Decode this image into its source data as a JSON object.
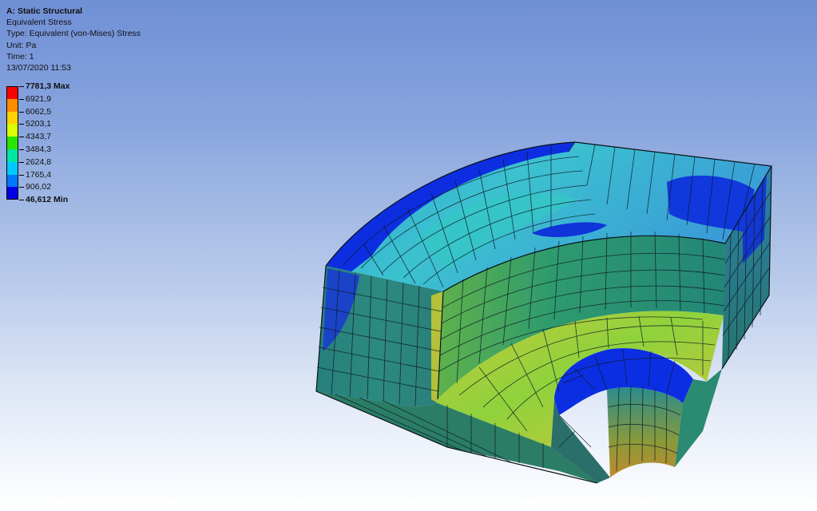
{
  "header": {
    "title": "A: Static Structural",
    "result": "Equivalent Stress",
    "type": "Type: Equivalent (von-Mises) Stress",
    "unit": "Unit: Pa",
    "time": "Time: 1",
    "date": "13/07/2020 11:53"
  },
  "legend": {
    "max_label": "7781,3 Max",
    "min_label": "46,612 Min",
    "labels": [
      "6921,9",
      "6062,5",
      "5203,1",
      "4343,7",
      "3484,3",
      "2624,8",
      "1765,4",
      "906,02"
    ],
    "colors": [
      "#ff0000",
      "#ff8c00",
      "#ffd200",
      "#d7ff00",
      "#28e600",
      "#00e6a0",
      "#00c8ff",
      "#0078ff",
      "#0000e6"
    ]
  },
  "colors": {
    "mesh_line": "#0d1a24",
    "deep_blue": "#0b2ad6",
    "teal": "#2d8f80",
    "cyan": "#2ec4d0",
    "yellow": "#c9d23a",
    "green": "#7dcc3a"
  }
}
